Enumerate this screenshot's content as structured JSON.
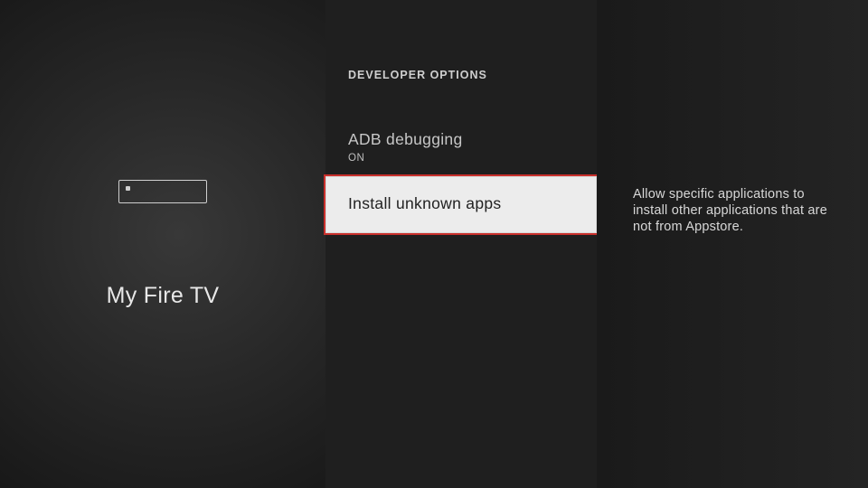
{
  "left": {
    "title": "My Fire TV"
  },
  "panel": {
    "heading": "DEVELOPER OPTIONS",
    "items": [
      {
        "label": "ADB debugging",
        "value": "ON",
        "selected": false
      },
      {
        "label": "Install unknown apps",
        "value": "",
        "selected": true
      }
    ]
  },
  "description": "Allow specific applications to install other applications that are not from Appstore."
}
